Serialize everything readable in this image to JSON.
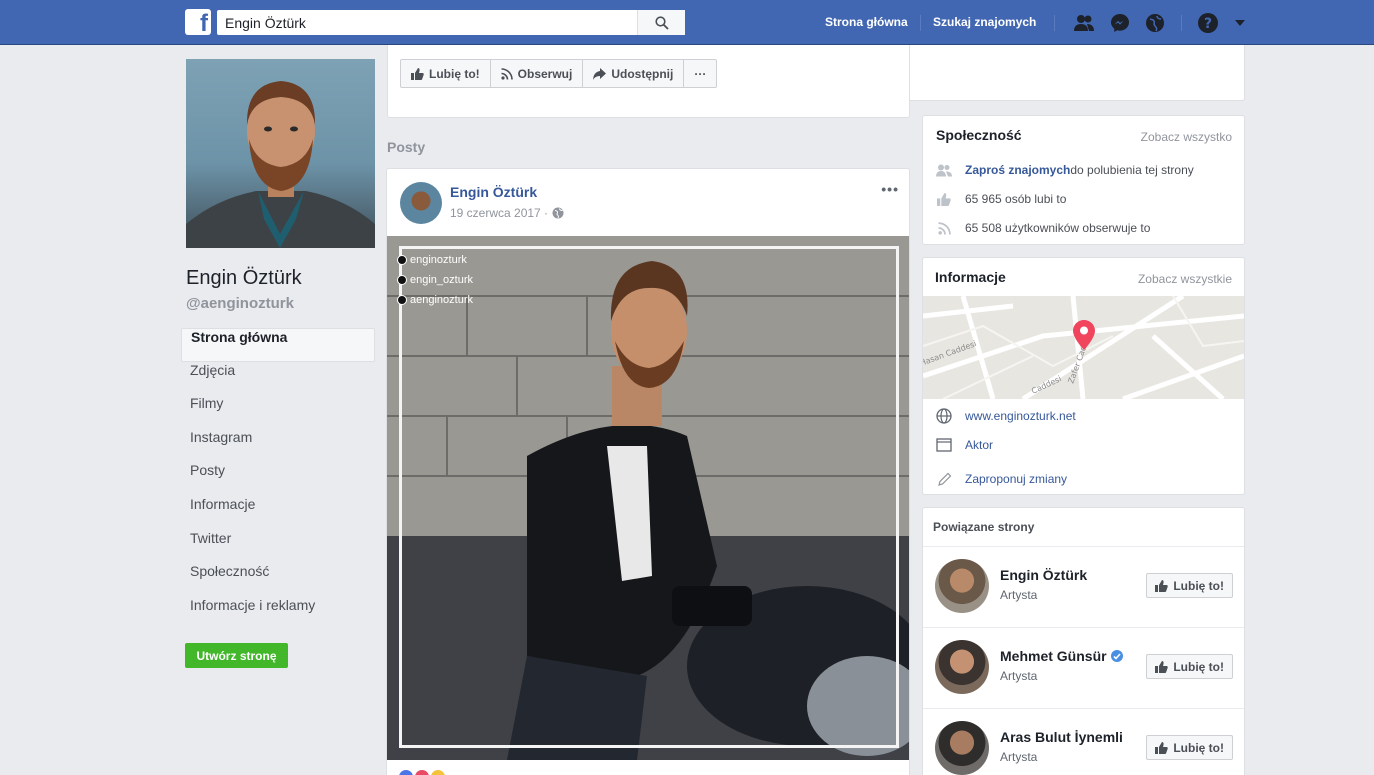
{
  "topbar": {
    "logo_letter": "f",
    "search_value": "Engin Öztürk",
    "nav": [
      "Strona główna",
      "Szukaj znajomych"
    ],
    "color": "#4267b2"
  },
  "profile": {
    "name": "Engin Öztürk",
    "handle": "@aenginozturk"
  },
  "side_nav": {
    "items": [
      {
        "label": "Strona główna",
        "active": true
      },
      {
        "label": "Zdjęcia"
      },
      {
        "label": "Filmy"
      },
      {
        "label": "Instagram"
      },
      {
        "label": "Posty"
      },
      {
        "label": "Informacje"
      },
      {
        "label": "Twitter"
      },
      {
        "label": "Społeczność"
      },
      {
        "label": "Informacje i reklamy"
      }
    ],
    "create_page": "Utwórz stronę"
  },
  "actions": {
    "like": "Lubię to!",
    "follow": "Obserwuj",
    "share": "Udostępnij",
    "more": "···"
  },
  "posts_section": "Posty",
  "post": {
    "author": "Engin Öztürk",
    "date": "19 czerwca 2017 ·",
    "dots": "•••",
    "social": [
      "enginozturk",
      "engin_ozturk",
      "aenginozturk"
    ]
  },
  "community": {
    "title": "Społeczność",
    "see_all": "Zobacz wszystko",
    "invite_link": "Zaproś znajomych",
    "invite_rest": " do polubienia tej strony",
    "likes": "65 965 osób lubi to",
    "follows": "65 508 użytkowników obserwuje to"
  },
  "info": {
    "title": "Informacje",
    "see_all": "Zobacz wszystkie",
    "website": "www.enginozturk.net",
    "category": "Aktor",
    "suggest": "Zaproponuj zmiany",
    "map_labels": [
      "Hasan Caddesi",
      "Caddesi",
      "Zafer Cad"
    ]
  },
  "related": {
    "title": "Powiązane strony",
    "like_label": "Lubię to!",
    "items": [
      {
        "name": "Engin Öztürk",
        "category": "Artysta",
        "verified": false
      },
      {
        "name": "Mehmet Günsür",
        "category": "Artysta",
        "verified": true
      },
      {
        "name": "Aras Bulut İynemli",
        "category": "Artysta",
        "verified": false
      }
    ]
  }
}
